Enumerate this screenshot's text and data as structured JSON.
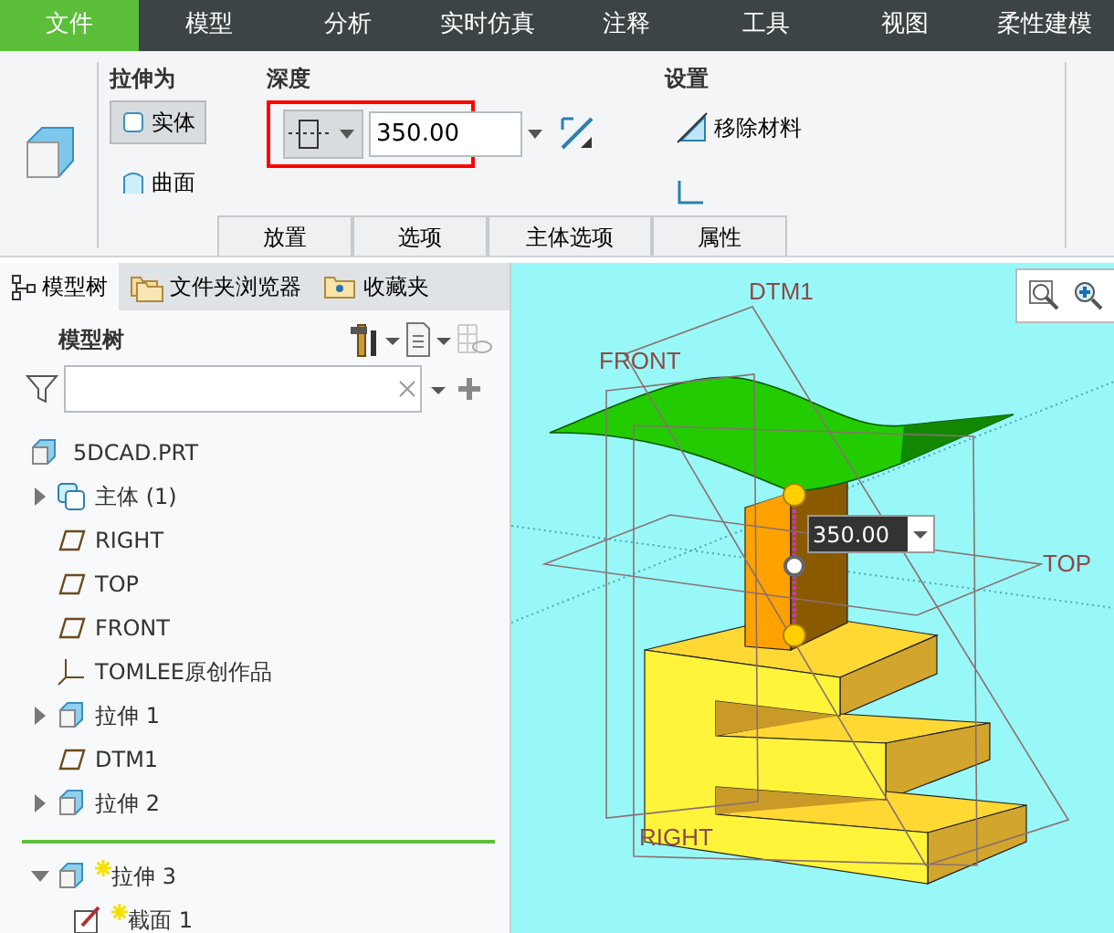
{
  "menu_tabs": [
    {
      "label": "文件",
      "selected": true
    },
    {
      "label": "模型",
      "selected": false
    },
    {
      "label": "分析",
      "selected": false
    },
    {
      "label": "实时仿真",
      "selected": false
    },
    {
      "label": "注释",
      "selected": false
    },
    {
      "label": "工具",
      "selected": false
    },
    {
      "label": "视图",
      "selected": false
    },
    {
      "label": "柔性建模",
      "selected": false
    }
  ],
  "ribbon": {
    "extrude_as": {
      "label": "拉伸为",
      "options": [
        {
          "label": "实体",
          "selected": true
        },
        {
          "label": "曲面",
          "selected": false
        }
      ]
    },
    "depth": {
      "label": "深度",
      "value": "350.00",
      "highlighted": true
    },
    "settings": {
      "label": "设置",
      "remove_material": {
        "label": "移除材料",
        "checked": false
      },
      "thicken": {
        "checked": false
      }
    },
    "tabs": [
      {
        "label": "放置"
      },
      {
        "label": "选项"
      },
      {
        "label": "主体选项"
      },
      {
        "label": "属性"
      }
    ]
  },
  "panel_tabs": [
    {
      "label": "模型树",
      "kind": "tree",
      "selected": true
    },
    {
      "label": "文件夹浏览器",
      "kind": "folder",
      "selected": false
    },
    {
      "label": "收藏夹",
      "kind": "favorites",
      "selected": false
    }
  ],
  "tree": {
    "title": "模型树",
    "items": [
      {
        "label": "5DCAD.PRT",
        "kind": "part"
      },
      {
        "label": "主体 (1)",
        "kind": "body",
        "expanded": false
      },
      {
        "label": "RIGHT",
        "kind": "plane"
      },
      {
        "label": "TOP",
        "kind": "plane"
      },
      {
        "label": "FRONT",
        "kind": "plane"
      },
      {
        "label": "TOMLEE原创作品",
        "kind": "csys"
      },
      {
        "label": "拉伸 1",
        "kind": "extrude",
        "expanded": false
      },
      {
        "label": "DTM1",
        "kind": "plane"
      },
      {
        "label": "拉伸 2",
        "kind": "extrude",
        "expanded": false
      }
    ],
    "items_after_insert_marker": [
      {
        "label": "拉伸 3",
        "kind": "extrude",
        "expanded": true,
        "new": true,
        "children": [
          {
            "label": "截面 1",
            "kind": "sketch",
            "new": true
          }
        ]
      }
    ]
  },
  "viewport": {
    "datum_labels": [
      "DTM1",
      "FRONT",
      "TOP",
      "RIGHT"
    ],
    "dimension": {
      "value": "350.00"
    }
  }
}
